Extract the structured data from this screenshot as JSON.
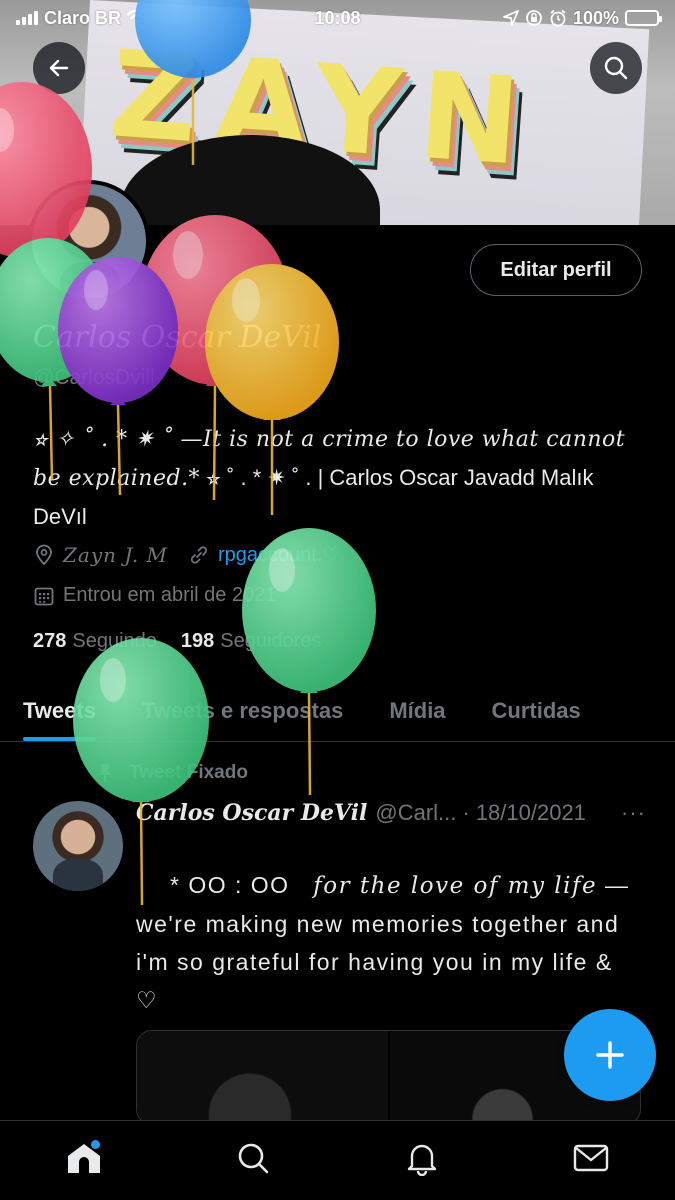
{
  "status_bar": {
    "carrier": "Claro BR",
    "time": "10:08",
    "battery": "100%",
    "battery_level": 1.0
  },
  "header": {
    "back_icon": "arrow-left-icon",
    "search_icon": "search-icon",
    "edit_profile": "Editar perfil"
  },
  "profile": {
    "display_name": "Carlos Oscar DeVil",
    "handle": "@CarlosDvill",
    "bio_italic": "⭐︎ ✧ ˚ . * ✷ ˚ —It is not a crime to love what cannot be explained.*",
    "bio_tail_symbols": " ⭐︎ ˚ . * ✷ ˚ . ",
    "bio_plain": "| Carlos Oscar Javadd Malık DeVıl",
    "location": "Zayn J. M",
    "website": "rpgaccount.♡",
    "joined": "Entrou em abril de 2021",
    "following_count": "278",
    "following_label": "Seguindo",
    "followers_count": "198",
    "followers_label": "Seguidores"
  },
  "tabs": [
    {
      "label": "Tweets",
      "active": true
    },
    {
      "label": "Tweets e respostas",
      "active": false
    },
    {
      "label": "Mídia",
      "active": false
    },
    {
      "label": "Curtidas",
      "active": false
    }
  ],
  "pinned_tweet": {
    "pinned_label": "Tweet Fixado",
    "author_name": "Carlos Oscar DeVil",
    "author_handle": "@Carl...",
    "date": "· 18/10/2021",
    "more": "···",
    "text_prefix": "* OO : OO",
    "text_italic": "for the love of my life",
    "text_body": "— we're making new memories together and i'm so grateful for having you in my life & ♡"
  },
  "bottom_nav": [
    {
      "icon": "home-icon",
      "active": true
    },
    {
      "icon": "search-icon",
      "active": false
    },
    {
      "icon": "bell-icon",
      "active": false
    },
    {
      "icon": "mail-icon",
      "active": false
    }
  ],
  "colors": {
    "accent": "#1d9bf0",
    "background": "#000000",
    "text_primary": "#e7e9ea",
    "text_secondary": "#71767b",
    "battery": "#ffd60a"
  },
  "overlay": {
    "balloon_icon": "balloon-icon"
  }
}
